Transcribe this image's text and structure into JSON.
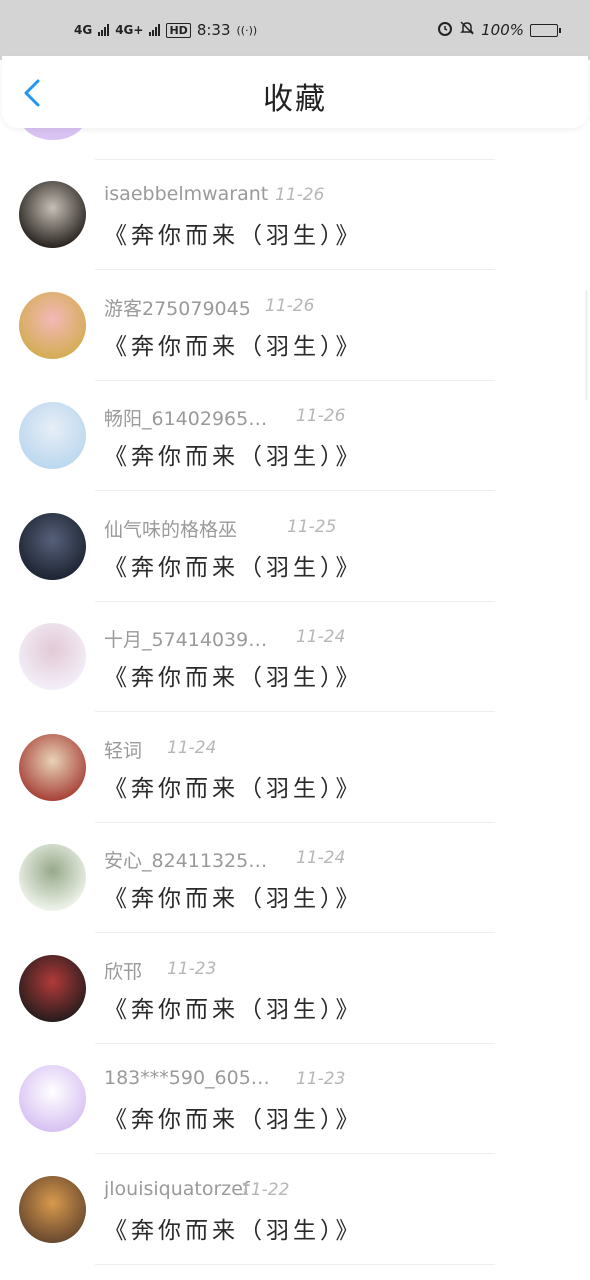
{
  "status_bar": {
    "network1": "4G",
    "network2": "4G+",
    "hd": "HD",
    "time": "8:33",
    "battery": "100%",
    "icons": [
      "signal-icon",
      "signal-icon",
      "hd-icon",
      "hotspot-icon",
      "alarm-icon",
      "mute-icon",
      "battery-icon"
    ]
  },
  "header": {
    "title": "收藏",
    "back_icon": "chevron-left-icon",
    "accent": "#2196f3"
  },
  "items": [
    {
      "name": "isaebbelmwarant",
      "date": "11-26",
      "song": "《奔你而来（羽生）》",
      "avatar_colors": [
        "#2b2622",
        "#c7bfb6"
      ]
    },
    {
      "name": "游客275079045",
      "date": "11-26",
      "song": "《奔你而来（羽生）》",
      "avatar_colors": [
        "#d4ad55",
        "#f3b8b8"
      ]
    },
    {
      "name": "畅阳_61402965…",
      "date": "11-26",
      "song": "《奔你而来（羽生）》",
      "avatar_colors": [
        "#bcd8ef",
        "#e7eef6"
      ]
    },
    {
      "name": "仙气味的格格巫",
      "date": "11-25",
      "song": "《奔你而来（羽生）》",
      "avatar_colors": [
        "#1e2533",
        "#56607a"
      ]
    },
    {
      "name": "十月_57414039…",
      "date": "11-24",
      "song": "《奔你而来（羽生）》",
      "avatar_colors": [
        "#f3eef8",
        "#e2c9d6"
      ]
    },
    {
      "name": "轻词",
      "date": "11-24",
      "song": "《奔你而来（羽生）》",
      "avatar_colors": [
        "#a8443a",
        "#e9d3b8"
      ]
    },
    {
      "name": "安心_82411325…",
      "date": "11-24",
      "song": "《奔你而来（羽生）》",
      "avatar_colors": [
        "#eef3ea",
        "#97a98a"
      ]
    },
    {
      "name": "欣邗",
      "date": "11-23",
      "song": "《奔你而来（羽生）》",
      "avatar_colors": [
        "#2a1d1d",
        "#b23a3a"
      ]
    },
    {
      "name": "183***590_605…",
      "date": "11-23",
      "song": "《奔你而来（羽生）》",
      "avatar_colors": [
        "#d8c2f3",
        "#ffffff"
      ]
    },
    {
      "name": "jlouisiquatorzef",
      "date": "11-22",
      "song": "《奔你而来（羽生）》",
      "avatar_colors": [
        "#6b4a2f",
        "#d89a4d"
      ]
    }
  ]
}
